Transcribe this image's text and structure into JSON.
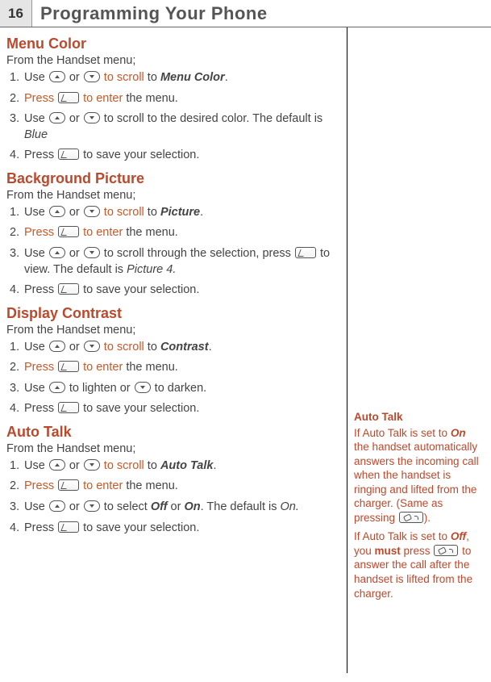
{
  "page_number": "16",
  "chapter_title": "Programming Your Phone",
  "sections": {
    "menu_color": {
      "title": "Menu Color",
      "intro": "From the Handset menu;",
      "step1_a": "Use ",
      "step1_b": " or ",
      "step1_c": " to scroll",
      "step1_d": " to ",
      "step1_e": "Menu Color",
      "step1_f": ".",
      "step2_a": "Press ",
      "step2_b": " to enter",
      "step2_c": " the menu.",
      "step3_a": "Use ",
      "step3_b": " or ",
      "step3_c": " to scroll to the desired color. The default is ",
      "step3_d": "Blue",
      "step4_a": "Press ",
      "step4_b": " to save your selection."
    },
    "background_picture": {
      "title": "Background Picture",
      "intro": "From the Handset menu;",
      "step1_a": "Use ",
      "step1_b": " or ",
      "step1_c": " to scroll",
      "step1_d": " to ",
      "step1_e": "Picture",
      "step1_f": ".",
      "step2_a": "Press ",
      "step2_b": " to enter",
      "step2_c": " the menu.",
      "step3_a": "Use ",
      "step3_b": " or ",
      "step3_c": " to scroll through the selection, press ",
      "step3_d": " to view. The default is ",
      "step3_e": "Picture 4.",
      "step4_a": "Press ",
      "step4_b": " to save your selection."
    },
    "display_contrast": {
      "title": "Display Contrast",
      "intro": "From the Handset menu;",
      "step1_a": "Use ",
      "step1_b": " or ",
      "step1_c": " to scroll",
      "step1_d": " to ",
      "step1_e": "Contrast",
      "step1_f": ".",
      "step2_a": "Press ",
      "step2_b": " to enter",
      "step2_c": " the menu.",
      "step3_a": "Use ",
      "step3_b": " to lighten or ",
      "step3_c": " to darken.",
      "step4_a": "Press ",
      "step4_b": " to save your selection."
    },
    "auto_talk": {
      "title": "Auto Talk",
      "intro": "From the Handset menu;",
      "step1_a": "Use ",
      "step1_b": " or ",
      "step1_c": " to scroll",
      "step1_d": " to ",
      "step1_e": "Auto Talk",
      "step1_f": ".",
      "step2_a": "Press ",
      "step2_b": " to enter",
      "step2_c": " the menu.",
      "step3_a": "Use ",
      "step3_b": " or ",
      "step3_c": " to select ",
      "step3_d": "Off",
      "step3_e": " or ",
      "step3_f": "On",
      "step3_g": ". The default is ",
      "step3_h": "On.",
      "step4_a": "Press ",
      "step4_b": " to save your selection."
    }
  },
  "sidebar": {
    "title": "Auto Talk",
    "p1_a": "If Auto Talk is set to ",
    "p1_b": "On",
    "p1_c": " the handset automatically answers the incoming call when the handset is ringing and lifted from the charger. (Same as pressing ",
    "p1_d": ").",
    "p2_a": "If Auto Talk is set to ",
    "p2_b": "Off",
    "p2_c": ", you ",
    "p2_d": "must",
    "p2_e": " press ",
    "p2_f": " to answer the call after the handset is lifted from the charger."
  }
}
